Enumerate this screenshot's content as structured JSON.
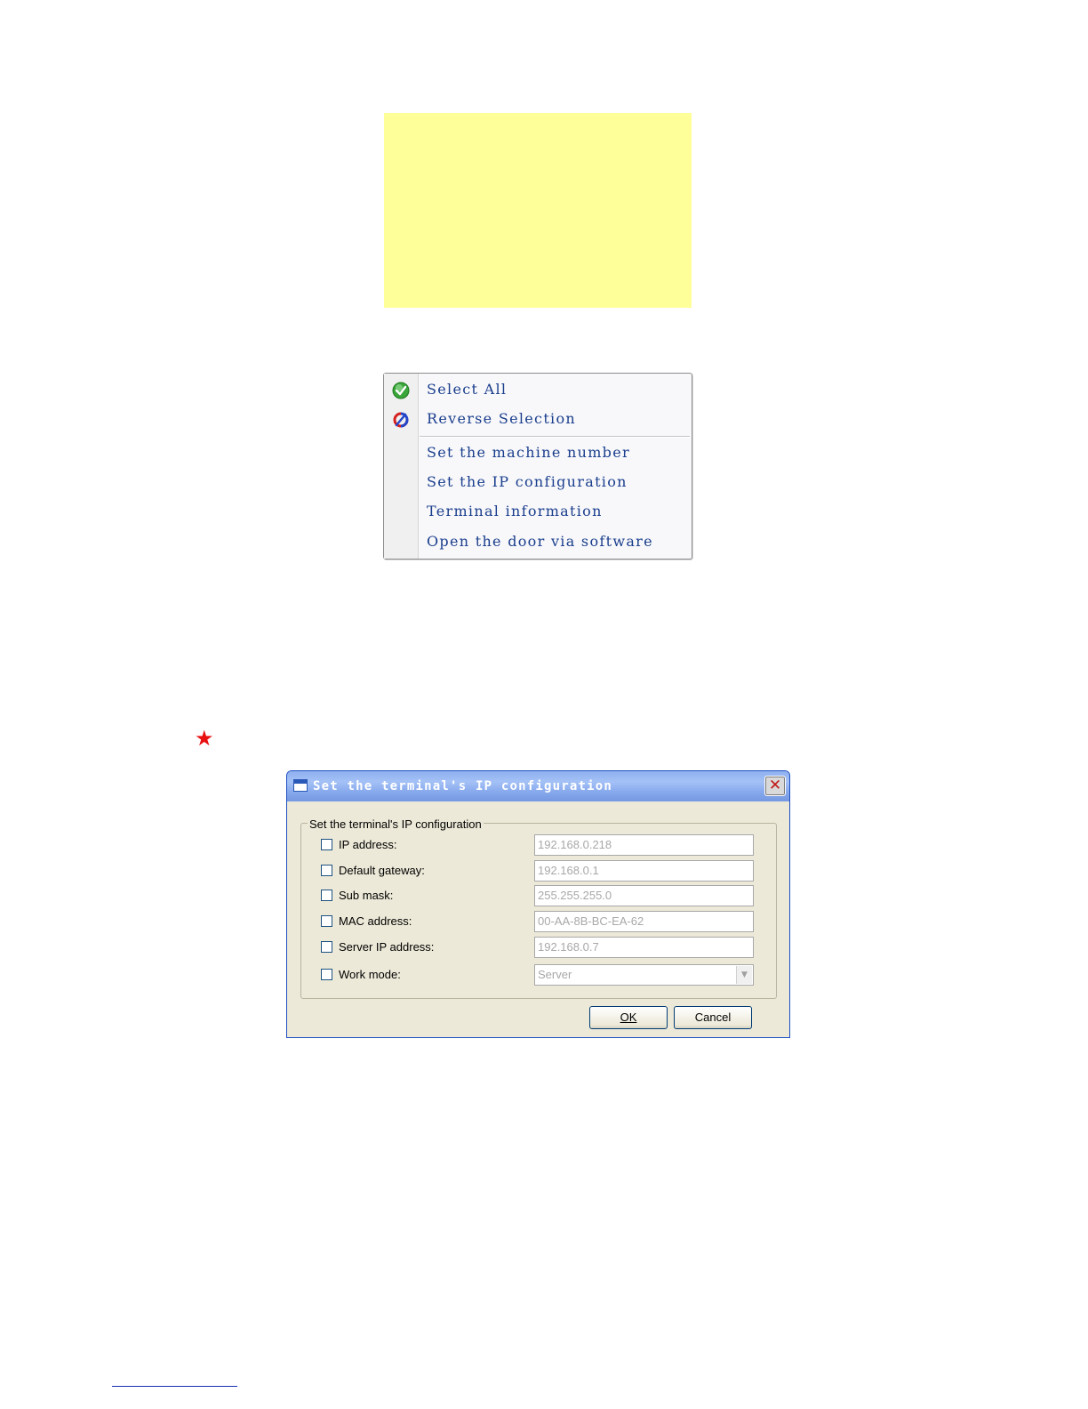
{
  "context_menu": {
    "items": [
      {
        "label": "Select All",
        "icon": "green-check-icon"
      },
      {
        "label": "Reverse Selection",
        "icon": "reverse-selection-icon"
      },
      {
        "label": "Set the machine number"
      },
      {
        "label": "Set the IP configuration"
      },
      {
        "label": "Terminal information"
      },
      {
        "label": "Open the door via software"
      }
    ]
  },
  "star": {
    "symbol": "★",
    "color": "#e81010"
  },
  "dialog": {
    "title": "Set the terminal's IP configuration",
    "group_title": "Set the terminal's IP configuration",
    "fields": [
      {
        "label": "IP address:",
        "value": "192.168.0.218",
        "checked": false
      },
      {
        "label": "Default gateway:",
        "value": "192.168.0.1",
        "checked": false
      },
      {
        "label": "Sub mask:",
        "value": "255.255.255.0",
        "checked": false
      },
      {
        "label": "MAC address:",
        "value": "00-AA-8B-BC-EA-62",
        "checked": false
      },
      {
        "label": "Server IP address:",
        "value": "192.168.0.7",
        "checked": false
      },
      {
        "label": "Work mode:",
        "value": "Server",
        "checked": false,
        "type": "select"
      }
    ],
    "ok_label": "OK",
    "cancel_label": "Cancel",
    "close_symbol": "✕"
  }
}
